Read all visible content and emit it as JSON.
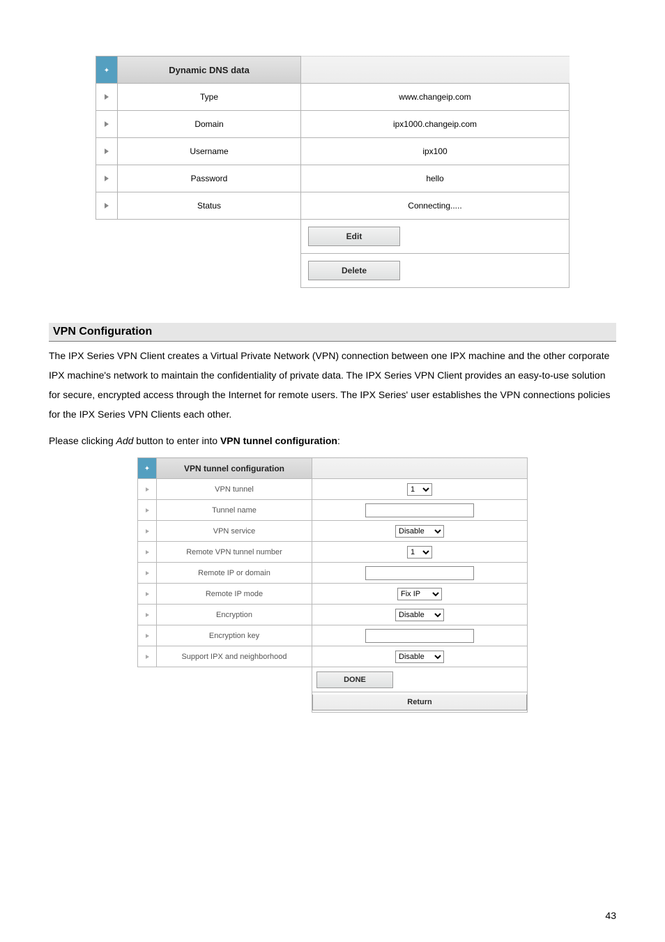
{
  "dns": {
    "header": "Dynamic DNS data",
    "rows": [
      {
        "label": "Type",
        "value": "www.changeip.com"
      },
      {
        "label": "Domain",
        "value": "ipx1000.changeip.com"
      },
      {
        "label": "Username",
        "value": "ipx100"
      },
      {
        "label": "Password",
        "value": "hello"
      },
      {
        "label": "Status",
        "value": "Connecting....."
      }
    ],
    "edit": "Edit",
    "delete": "Delete"
  },
  "section": {
    "heading": "VPN Configuration",
    "p1a": "The IPX Series VPN Client creates a Virtual Private Network (VPN) connection between one IPX machine and the other corporate IPX machine's network to maintain the confidentiality of private data. The IPX Series VPN Client provides an easy-to-use solution for secure, encrypted access through the Internet for remote users. The IPX Series' user establishes the VPN connections policies for the IPX Series VPN Clients each other.",
    "p2a": "Please clicking ",
    "p2i": "Add",
    "p2b": " button to enter into ",
    "p2s": "VPN tunnel configuration",
    "p2c": ":"
  },
  "vpn": {
    "header": "VPN tunnel configuration",
    "labels": {
      "vpn_tunnel": "VPN tunnel",
      "tunnel_name": "Tunnel name",
      "vpn_service": "VPN service",
      "remote_num": "Remote VPN tunnel number",
      "remote_ip": "Remote IP or domain",
      "remote_mode": "Remote IP mode",
      "encryption": "Encryption",
      "enc_key": "Encryption key",
      "support": "Support IPX and neighborhood"
    },
    "values": {
      "vpn_tunnel": "1",
      "tunnel_name": "",
      "vpn_service": "Disable",
      "remote_num": "1",
      "remote_ip": "",
      "remote_mode": "Fix IP",
      "encryption": "Disable",
      "enc_key": "",
      "support": "Disable"
    },
    "done": "DONE",
    "return": "Return"
  },
  "page_number": "43"
}
